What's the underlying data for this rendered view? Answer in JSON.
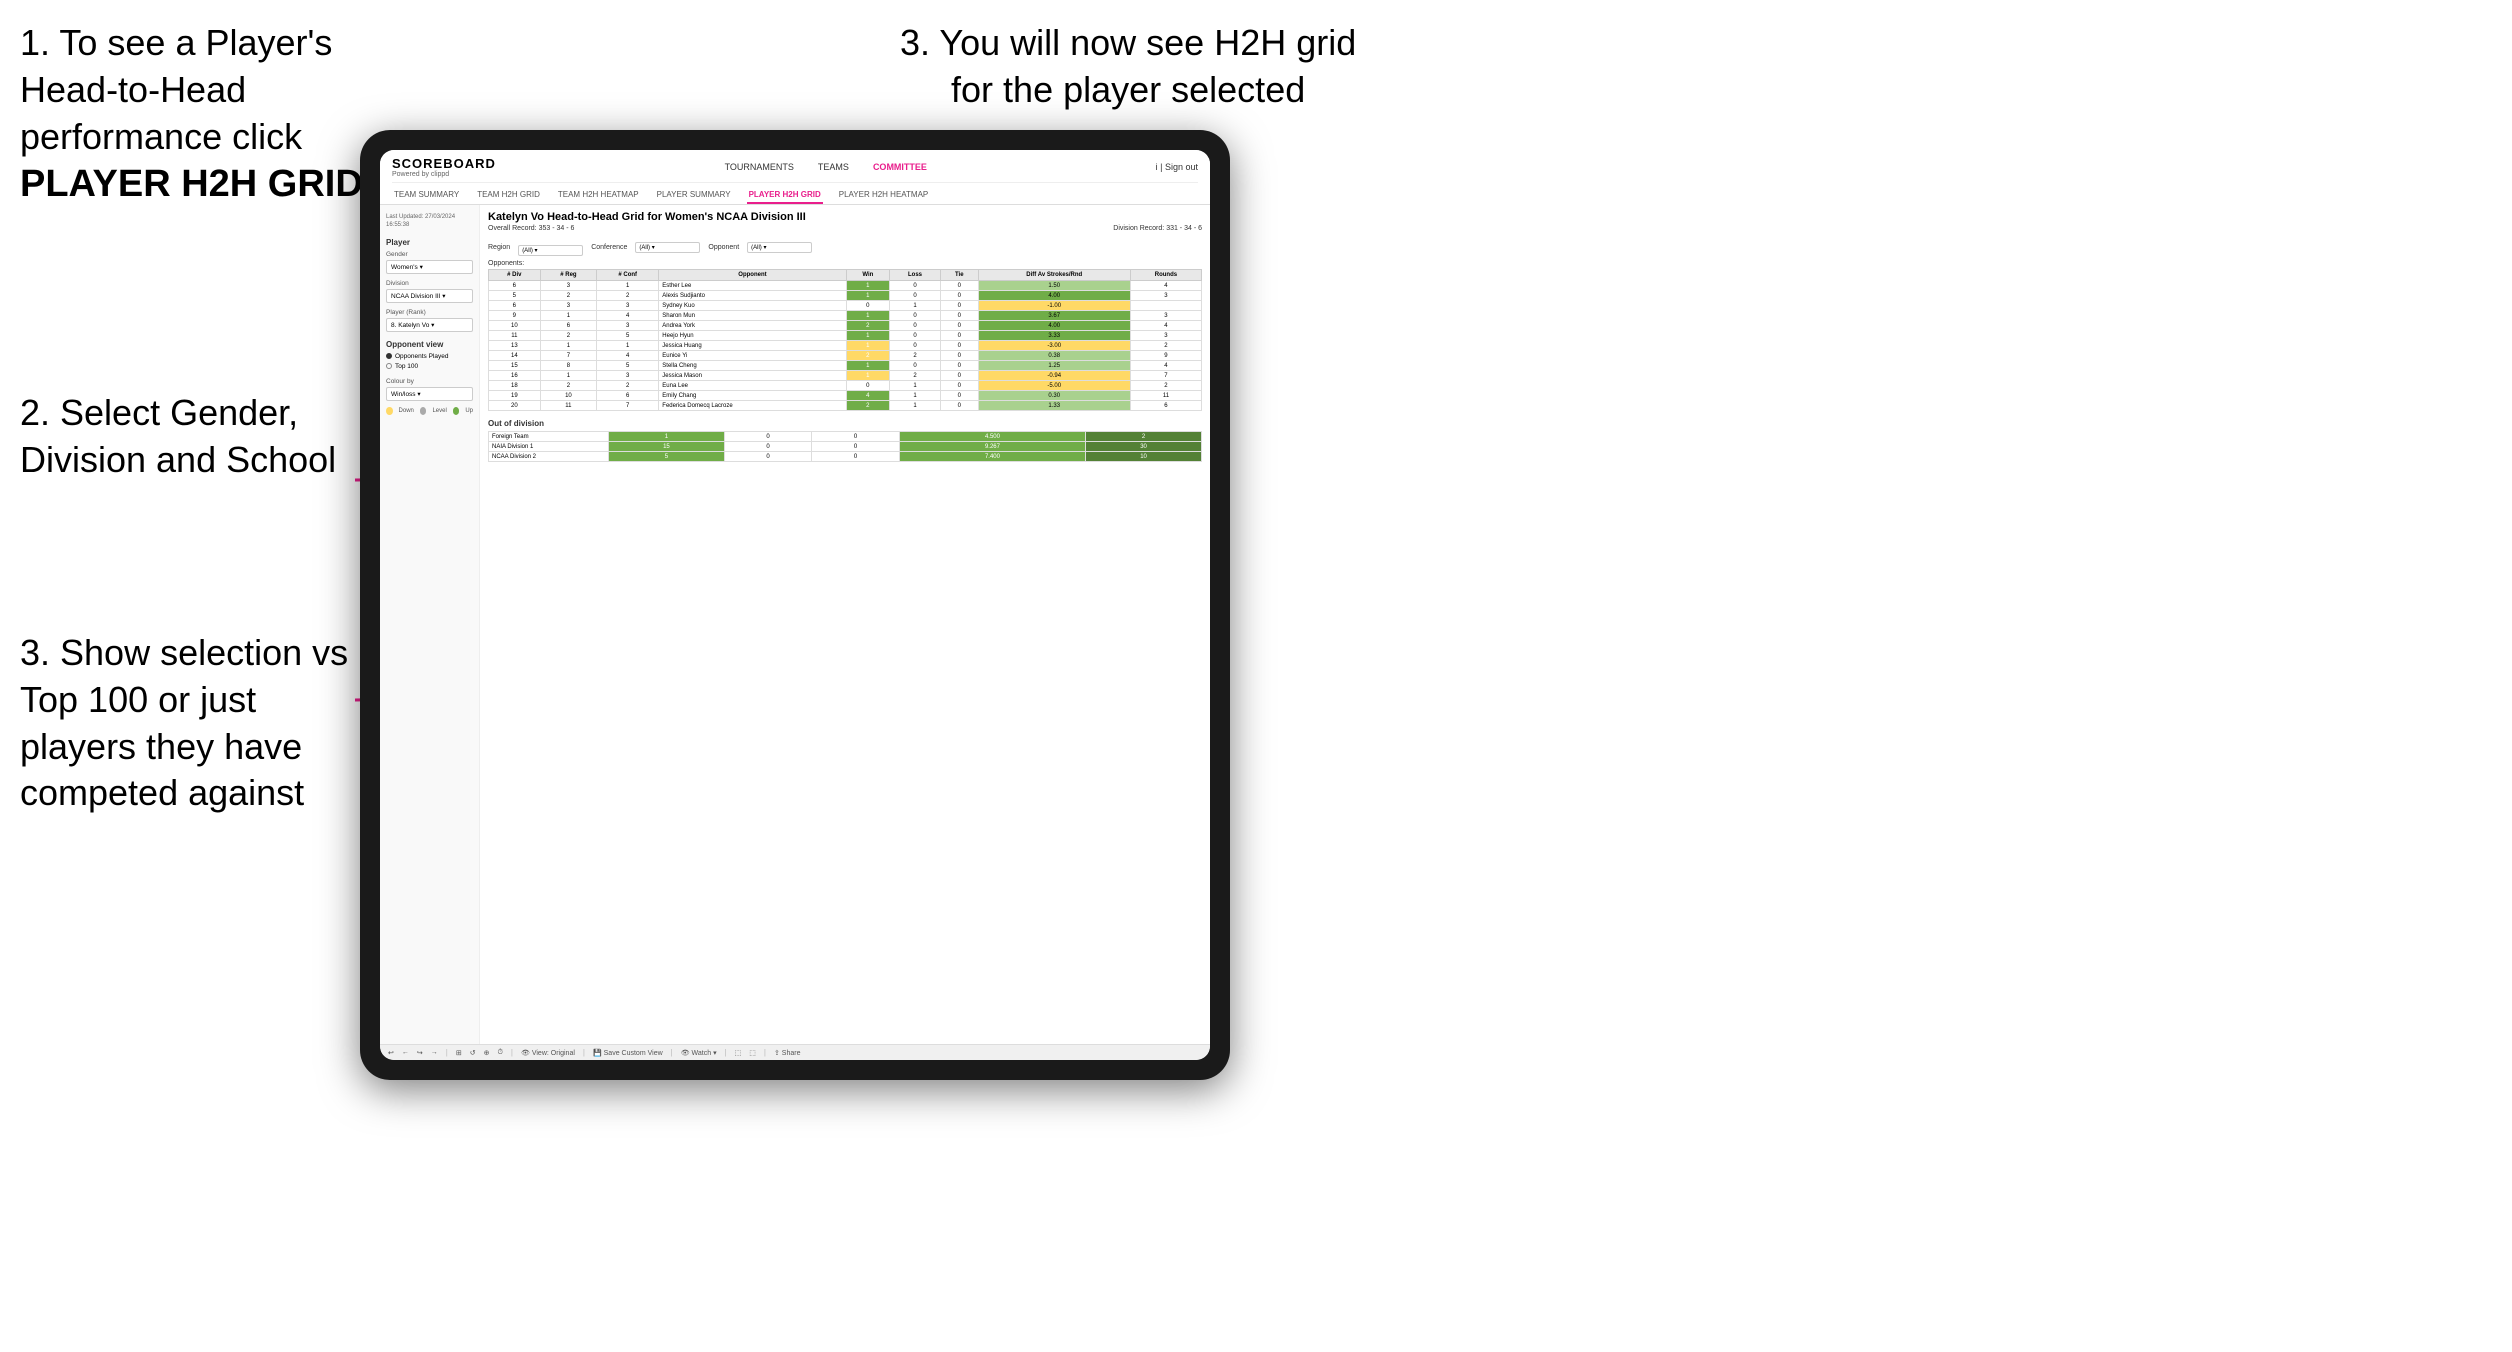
{
  "instructions": {
    "step1_title": "1. To see a Player's Head-to-Head performance click",
    "step1_bold": "PLAYER H2H GRID",
    "step2": "2. Select Gender, Division and School",
    "step3_left": "3. Show selection vs Top 100 or just players they have competed against",
    "step3_top_line1": "3. You will now see H2H grid",
    "step3_top_line2": "for the player selected"
  },
  "nav": {
    "logo": "SCOREBOARD",
    "logo_sub": "Powered by clippd",
    "links": [
      "TOURNAMENTS",
      "TEAMS",
      "COMMITTEE"
    ],
    "active_link": "COMMITTEE",
    "sign_out": "Sign out",
    "sub_links": [
      "TEAM SUMMARY",
      "TEAM H2H GRID",
      "TEAM H2H HEATMAP",
      "PLAYER SUMMARY",
      "PLAYER H2H GRID",
      "PLAYER H2H HEATMAP"
    ],
    "active_sub": "PLAYER H2H GRID"
  },
  "sidebar": {
    "last_updated_label": "Last Updated: 27/03/2024",
    "last_updated_time": "16:55:38",
    "player_label": "Player",
    "gender_label": "Gender",
    "gender_value": "Women's",
    "division_label": "Division",
    "division_value": "NCAA Division III",
    "player_rank_label": "Player (Rank)",
    "player_rank_value": "8. Katelyn Vo",
    "opponent_view_label": "Opponent view",
    "opponent_option1": "Opponents Played",
    "opponent_option2": "Top 100",
    "colour_by_label": "Colour by",
    "colour_by_value": "Win/loss",
    "legend": [
      {
        "color": "#ffd966",
        "label": "Down"
      },
      {
        "color": "#aaaaaa",
        "label": "Level"
      },
      {
        "color": "#70ad47",
        "label": "Up"
      }
    ]
  },
  "grid": {
    "title": "Katelyn Vo Head-to-Head Grid for Women's NCAA Division III",
    "overall_record_label": "Overall Record:",
    "overall_record": "353 - 34 - 6",
    "division_record_label": "Division Record:",
    "division_record": "331 - 34 - 6",
    "filter_opponents_label": "Opponents:",
    "filter_region_label": "Region",
    "filter_conference_label": "Conference",
    "filter_opponent_label": "Opponent",
    "filter_all": "(All)",
    "table_headers": [
      "# Div",
      "# Reg",
      "# Conf",
      "Opponent",
      "Win",
      "Loss",
      "Tie",
      "Diff Av Strokes/Rnd",
      "Rounds"
    ],
    "rows": [
      {
        "div": 6,
        "reg": 3,
        "conf": 1,
        "opponent": "Esther Lee",
        "win": 1,
        "loss": 0,
        "tie": 0,
        "diff": "1.50",
        "rounds": 4,
        "win_color": "green",
        "loss_color": "white"
      },
      {
        "div": 5,
        "reg": 2,
        "conf": 2,
        "opponent": "Alexis Sudjianto",
        "win": 1,
        "loss": 0,
        "tie": 0,
        "diff": "4.00",
        "rounds": 3,
        "win_color": "green"
      },
      {
        "div": 6,
        "reg": 3,
        "conf": 3,
        "opponent": "Sydney Kuo",
        "win": 0,
        "loss": 1,
        "tie": 0,
        "diff": "-1.00",
        "rounds": "",
        "win_color": "white"
      },
      {
        "div": 9,
        "reg": 1,
        "conf": 4,
        "opponent": "Sharon Mun",
        "win": 1,
        "loss": 0,
        "tie": 0,
        "diff": "3.67",
        "rounds": 3,
        "win_color": "green"
      },
      {
        "div": 10,
        "reg": 6,
        "conf": 3,
        "opponent": "Andrea York",
        "win": 2,
        "loss": 0,
        "tie": 0,
        "diff": "4.00",
        "rounds": 4,
        "win_color": "green"
      },
      {
        "div": 11,
        "reg": 2,
        "conf": 5,
        "opponent": "Heejo Hyun",
        "win": 1,
        "loss": 0,
        "tie": 0,
        "diff": "3.33",
        "rounds": 3,
        "win_color": "green"
      },
      {
        "div": 13,
        "reg": 1,
        "conf": 1,
        "opponent": "Jessica Huang",
        "win": 1,
        "loss": 0,
        "tie": 0,
        "diff": "-3.00",
        "rounds": 2,
        "win_color": "yellow"
      },
      {
        "div": 14,
        "reg": 7,
        "conf": 4,
        "opponent": "Eunice Yi",
        "win": 2,
        "loss": 2,
        "tie": 0,
        "diff": "0.38",
        "rounds": 9,
        "win_color": "yellow"
      },
      {
        "div": 15,
        "reg": 8,
        "conf": 5,
        "opponent": "Stella Cheng",
        "win": 1,
        "loss": 0,
        "tie": 0,
        "diff": "1.25",
        "rounds": 4,
        "win_color": "green"
      },
      {
        "div": 16,
        "reg": 1,
        "conf": 3,
        "opponent": "Jessica Mason",
        "win": 1,
        "loss": 2,
        "tie": 0,
        "diff": "-0.94",
        "rounds": 7,
        "win_color": "yellow"
      },
      {
        "div": 18,
        "reg": 2,
        "conf": 2,
        "opponent": "Euna Lee",
        "win": 0,
        "loss": 1,
        "tie": 0,
        "diff": "-5.00",
        "rounds": 2,
        "win_color": "white"
      },
      {
        "div": 19,
        "reg": 10,
        "conf": 6,
        "opponent": "Emily Chang",
        "win": 4,
        "loss": 1,
        "tie": 0,
        "diff": "0.30",
        "rounds": 11,
        "win_color": "green"
      },
      {
        "div": 20,
        "reg": 11,
        "conf": 7,
        "opponent": "Federica Domecq Lacroze",
        "win": 2,
        "loss": 1,
        "tie": 0,
        "diff": "1.33",
        "rounds": 6,
        "win_color": "green"
      }
    ],
    "out_of_division_label": "Out of division",
    "out_of_division_rows": [
      {
        "name": "Foreign Team",
        "win": 1,
        "loss": 0,
        "tie": 0,
        "diff": "4.500",
        "rounds": 2
      },
      {
        "name": "NAIA Division 1",
        "win": 15,
        "loss": 0,
        "tie": 0,
        "diff": "9.267",
        "rounds": 30
      },
      {
        "name": "NCAA Division 2",
        "win": 5,
        "loss": 0,
        "tie": 0,
        "diff": "7.400",
        "rounds": 10
      }
    ]
  },
  "toolbar": {
    "items": [
      "↩",
      "←",
      "↪",
      "→",
      "⊞",
      "↺",
      "⊕",
      "⏱",
      "View: Original",
      "Save Custom View",
      "Watch ▾",
      "⬚",
      "⬚",
      "Share"
    ]
  }
}
